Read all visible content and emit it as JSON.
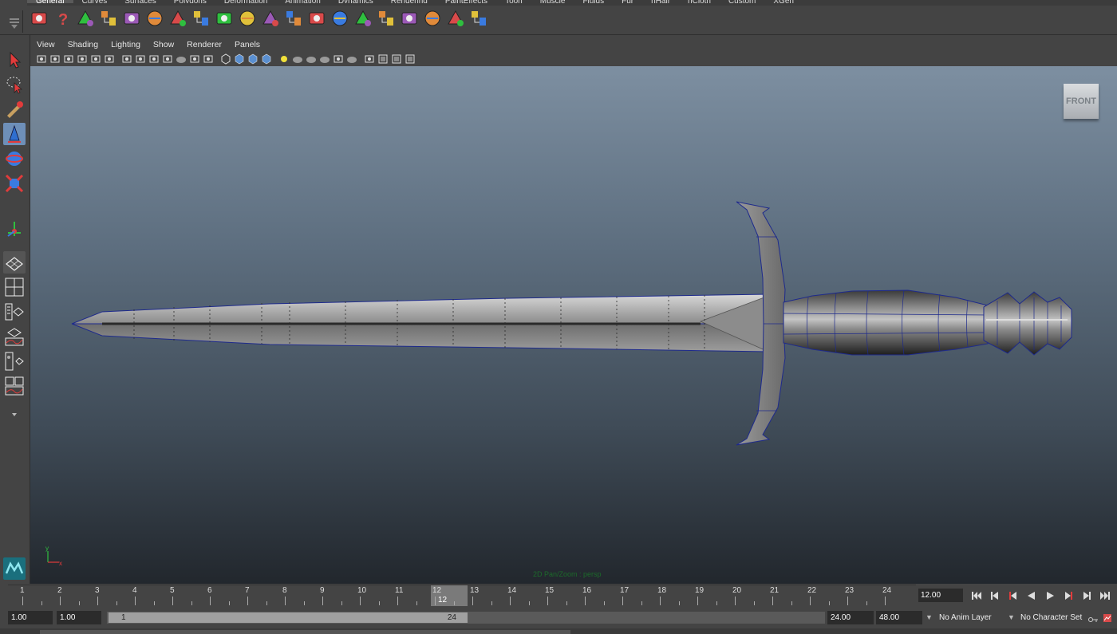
{
  "shelf_tabs": [
    "General",
    "Curves",
    "Surfaces",
    "Polygons",
    "Deformation",
    "Animation",
    "Dynamics",
    "Rendering",
    "PaintEffects",
    "Toon",
    "Muscle",
    "Fluids",
    "Fur",
    "nHair",
    "nCloth",
    "Custom",
    "XGen"
  ],
  "shelf_icons": [
    "render-view-icon",
    "help-icon",
    "render-icon",
    "ipr-render-icon",
    "render-settings-icon",
    "hypershade-icon",
    "paint-icon",
    "rotate-icon",
    "sphere-light-icon",
    "graph-editor-icon",
    "hypergraph-icon",
    "outliner-icon",
    "connection-editor-icon",
    "attribute-editor-icon",
    "light-icon",
    "cube-shader-icon",
    "texture-cube-icon",
    "paint-brush-icon",
    "lattice-icon",
    "manipulator-icon"
  ],
  "panel_menu": [
    "View",
    "Shading",
    "Lighting",
    "Show",
    "Renderer",
    "Panels"
  ],
  "panel_toolbar_icons": [
    "select-camera-icon",
    "camera-attributes-icon",
    "bookmarks-icon",
    "image-plane-icon",
    "two-d-pan-icon",
    "grease-pencil-icon",
    "grid-icon",
    "film-gate-icon",
    "resolution-gate-icon",
    "gate-mask-icon",
    "field-chart-icon",
    "safe-action-icon",
    "safe-title-icon",
    "wireframe-icon",
    "smooth-shade-icon",
    "wireframe-on-shaded-icon",
    "textured-icon",
    "use-all-lights-icon",
    "shadows-icon",
    "screen-space-ao-icon",
    "motion-blur-icon",
    "multisample-aa-icon",
    "depth-of-field-icon",
    "isolate-select-icon",
    "xray-icon",
    "xray-joints-icon",
    "xray-active-icon"
  ],
  "view_cube_label": "FRONT",
  "hud_message": "2D Pan/Zoom : persp",
  "timeline": {
    "frames": [
      "1",
      "2",
      "3",
      "4",
      "5",
      "6",
      "7",
      "8",
      "9",
      "10",
      "11",
      "12",
      "13",
      "14",
      "15",
      "16",
      "17",
      "18",
      "19",
      "20",
      "21",
      "22",
      "23",
      "24"
    ],
    "current_frame": "12",
    "current_time": "12.00"
  },
  "range": {
    "start_time": "1.00",
    "playback_start": "1.00",
    "range_start_label": "1",
    "range_end_label": "24",
    "playback_end": "24.00",
    "end_time": "48.00"
  },
  "anim_layer": "No Anim Layer",
  "character_set": "No Character Set",
  "axis": {
    "y": "y",
    "x": "x"
  },
  "colors": {
    "wireframe": "#1e2a8c",
    "selected_tool": "#6e8fb8"
  }
}
